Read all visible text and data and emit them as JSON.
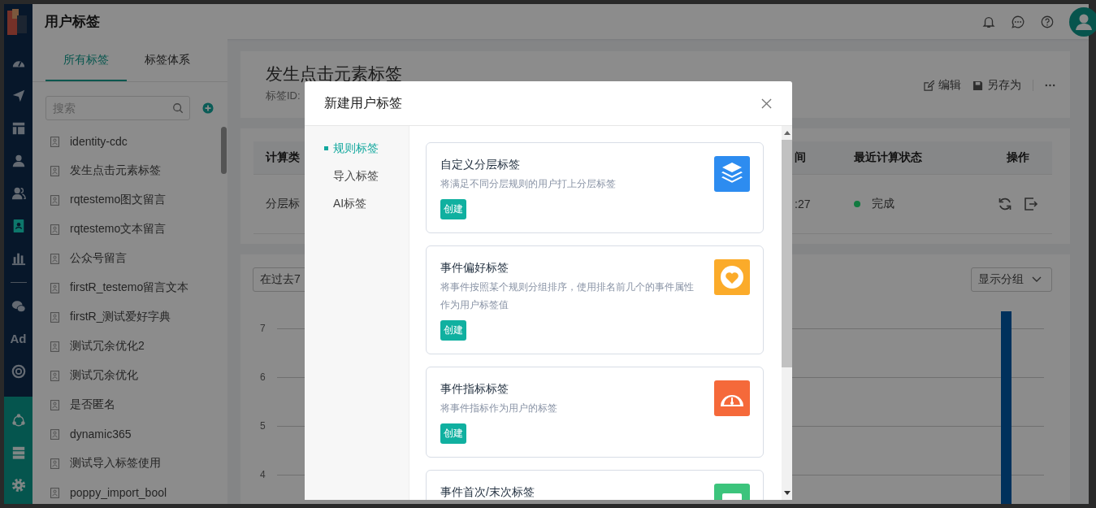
{
  "header": {
    "title": "用户标签"
  },
  "nav": {
    "items": [
      {
        "kind": "gauge",
        "selected": false
      },
      {
        "kind": "plane",
        "selected": false
      },
      {
        "kind": "layout",
        "selected": false
      },
      {
        "kind": "user",
        "selected": false
      },
      {
        "kind": "users",
        "selected": false
      },
      {
        "kind": "tag",
        "selected": true
      },
      {
        "kind": "chart",
        "selected": false
      },
      {
        "kind": "divider"
      },
      {
        "kind": "wechat",
        "selected": false
      },
      {
        "kind": "text",
        "label": "Ad",
        "selected": false
      },
      {
        "kind": "target",
        "selected": false
      }
    ],
    "bottom_items": [
      {
        "kind": "network"
      },
      {
        "kind": "server"
      },
      {
        "kind": "gear"
      }
    ]
  },
  "left_panel": {
    "tabs": [
      {
        "label": "所有标签",
        "selected": true
      },
      {
        "label": "标签体系",
        "selected": false
      }
    ],
    "search": {
      "placeholder": "搜索"
    },
    "tags": [
      "identity-cdc",
      "发生点击元素标签",
      "rqtestemo图文留言",
      "rqtestemo文本留言",
      "公众号留言",
      "firstR_testemo留言文本",
      "firstR_测试爱好字典",
      "测试冗余优化2",
      "测试冗余优化",
      "是否匿名",
      "dynamic365",
      "测试导入标签使用",
      "poppy_import_bool"
    ]
  },
  "detail": {
    "title": "发生点击元素标签",
    "id_label": "标签ID:",
    "actions": [
      {
        "kind": "edit",
        "label": "编辑"
      },
      {
        "kind": "save",
        "label": "另存为"
      }
    ],
    "table": {
      "columns": [
        "计算类",
        "间",
        "最近计算状态",
        "操作"
      ],
      "rows": [
        {
          "type": "分层标",
          "time": ":27",
          "status": {
            "label": "完成",
            "color": "#127a40"
          }
        }
      ]
    },
    "range_select": "在过去7",
    "group_select": "显示分组",
    "y_axis_labels": [
      "7",
      "6",
      "5",
      "4"
    ]
  },
  "modal": {
    "title": "新建用户标签",
    "menu": [
      {
        "label": "规则标签",
        "selected": true
      },
      {
        "label": "导入标签",
        "selected": false
      },
      {
        "label": "AI标签",
        "selected": false
      }
    ],
    "cards": [
      {
        "kind": "layers",
        "title": "自定义分层标签",
        "description": "将满足不同分层规则的用户打上分层标签",
        "button": "创建"
      },
      {
        "kind": "heart",
        "title": "事件偏好标签",
        "description": "将事件按照某个规则分组排序，使用排名前几个的事件属性作为用户标签值",
        "button": "创建"
      },
      {
        "kind": "gauge",
        "title": "事件指标标签",
        "description": "将事件指标作为用户的标签",
        "button": "创建"
      },
      {
        "kind": "card",
        "title": "事件首次/末次标签"
      }
    ]
  }
}
